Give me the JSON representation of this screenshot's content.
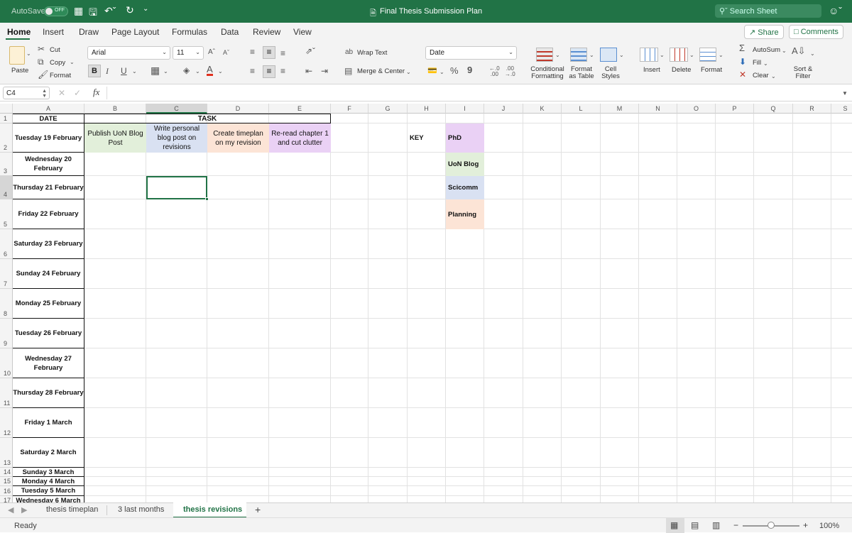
{
  "titlebar": {
    "autosave": "AutoSave",
    "autosave_state": "OFF",
    "title": "Final Thesis Submission Plan",
    "search_placeholder": "Search Sheet"
  },
  "ribbon_tabs": [
    "Home",
    "Insert",
    "Draw",
    "Page Layout",
    "Formulas",
    "Data",
    "Review",
    "View"
  ],
  "share_label": "Share",
  "comments_label": "Comments",
  "clipboard": {
    "paste": "Paste",
    "cut": "Cut",
    "copy": "Copy",
    "format": "Format"
  },
  "font": {
    "name": "Arial",
    "size": "11",
    "bold": "B",
    "italic": "I",
    "underline": "U"
  },
  "alignment": {
    "wrap": "Wrap Text",
    "merge": "Merge & Center"
  },
  "number": {
    "format": "Date",
    "percent": "%",
    "comma": "9"
  },
  "styles": {
    "conditional": "Conditional\nFormatting",
    "table": "Format\nas Table",
    "cell": "Cell\nStyles"
  },
  "cells_group": {
    "insert": "Insert",
    "delete": "Delete",
    "format": "Format"
  },
  "editing": {
    "autosum": "AutoSum",
    "fill": "Fill",
    "clear": "Clear",
    "sort": "Sort &\nFilter"
  },
  "formula_bar": {
    "name_box": "C4",
    "fx": "fx",
    "value": ""
  },
  "columns": [
    "A",
    "B",
    "C",
    "D",
    "E",
    "F",
    "G",
    "H",
    "I",
    "J",
    "K",
    "L",
    "M",
    "N",
    "O",
    "P",
    "Q",
    "R",
    "S"
  ],
  "rows": [
    "1",
    "2",
    "3",
    "4",
    "5",
    "6",
    "7",
    "8",
    "9",
    "10",
    "11",
    "12",
    "13",
    "14",
    "15",
    "16",
    "17"
  ],
  "headers": {
    "date": "DATE",
    "task": "TASK"
  },
  "dates": [
    "Tuesday 19 February",
    "Wednesday 20 February",
    "Thursday 21 February",
    "Friday 22 February",
    "Saturday 23 February",
    "Sunday 24 February",
    "Monday 25 February",
    "Tuesday 26 February",
    "Wednesday 27 February",
    "Thursday 28 February",
    "Friday 1 March",
    "Saturday 2 March",
    "Sunday 3 March",
    "Monday 4 March",
    "Tuesday 5 March",
    "Wednesday 6 March"
  ],
  "tasks": [
    {
      "text": "Publish UoN Blog Post",
      "color": "#e2efda"
    },
    {
      "text": "Write personal blog post on revisions",
      "color": "#d9e1f2"
    },
    {
      "text": "Create timeplan on my revision",
      "color": "#fce4d6"
    },
    {
      "text": "Re-read chapter 1 and cut clutter",
      "color": "#ead1f5"
    }
  ],
  "key": {
    "title": "KEY",
    "items": [
      {
        "label": "PhD",
        "color": "#ead1f5"
      },
      {
        "label": "UoN Blog",
        "color": "#e2efda"
      },
      {
        "label": "Scicomm",
        "color": "#d9e1f2"
      },
      {
        "label": "Planning",
        "color": "#fce4d6"
      }
    ]
  },
  "sheet_tabs": [
    "thesis timeplan",
    "3 last months",
    "thesis revisions"
  ],
  "active_sheet": "thesis revisions",
  "status": {
    "ready": "Ready",
    "zoom": "100%",
    "zoom_level": 1.0
  },
  "colors": {
    "accent": "#217346"
  }
}
